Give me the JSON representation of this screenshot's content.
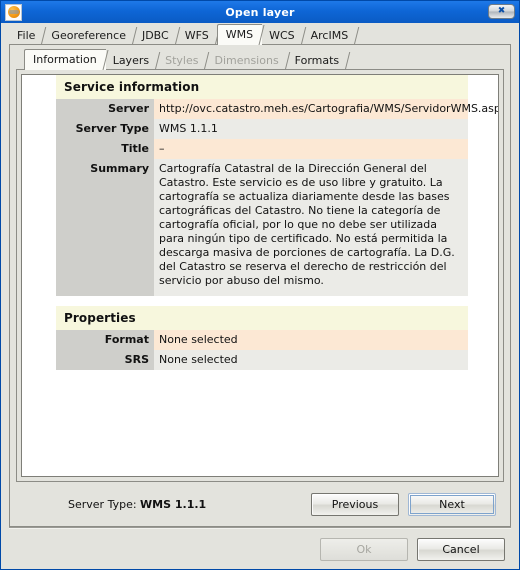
{
  "window": {
    "title": "Open layer",
    "icon": "app-globe-icon",
    "close_label": "✖"
  },
  "outer_tabs": [
    {
      "label": "File",
      "selected": false,
      "disabled": false
    },
    {
      "label": "Georeference",
      "selected": false,
      "disabled": false
    },
    {
      "label": "JDBC",
      "selected": false,
      "disabled": false
    },
    {
      "label": "WFS",
      "selected": false,
      "disabled": false
    },
    {
      "label": "WMS",
      "selected": true,
      "disabled": false
    },
    {
      "label": "WCS",
      "selected": false,
      "disabled": false
    },
    {
      "label": "ArcIMS",
      "selected": false,
      "disabled": false
    }
  ],
  "inner_tabs": [
    {
      "label": "Information",
      "selected": true,
      "disabled": false
    },
    {
      "label": "Layers",
      "selected": false,
      "disabled": false
    },
    {
      "label": "Styles",
      "selected": false,
      "disabled": true
    },
    {
      "label": "Dimensions",
      "selected": false,
      "disabled": true
    },
    {
      "label": "Formats",
      "selected": false,
      "disabled": false
    }
  ],
  "service_information": {
    "heading": "Service information",
    "rows": [
      {
        "label": "Server",
        "value": "http://ovc.catastro.meh.es/Cartografia/WMS/ServidorWMS.aspx"
      },
      {
        "label": "Server Type",
        "value": "WMS 1.1.1"
      },
      {
        "label": "Title",
        "value": "–"
      },
      {
        "label": "Summary",
        "value": "Cartografía Catastral de la Dirección General del Catastro. Este servicio es de uso libre y gratuito. La cartografía se actualiza diariamente desde las bases cartográficas del Catastro. No tiene la categoría de cartografía oficial, por lo que no debe ser utilizada para ningún tipo de certificado. No está permitida la descarga masiva de porciones de cartografía. La D.G. del Catastro se reserva el derecho de restricción del servicio por abuso del mismo."
      }
    ]
  },
  "properties": {
    "heading": "Properties",
    "rows": [
      {
        "label": "Format",
        "value": "None selected"
      },
      {
        "label": "SRS",
        "value": "None selected"
      }
    ]
  },
  "navbar": {
    "server_type_label": "Server Type:",
    "server_type_value": "WMS 1.1.1",
    "previous_label": "Previous",
    "next_label": "Next"
  },
  "bottombar": {
    "ok_label": "Ok",
    "cancel_label": "Cancel"
  },
  "colors": {
    "titlebar": "#0e66d6",
    "section_header": "#f7f7dd",
    "label_cell": "#cfcfcb",
    "value_peach": "#fce8d4",
    "value_gray": "#ebebe7",
    "panel": "#e3e3dd"
  }
}
